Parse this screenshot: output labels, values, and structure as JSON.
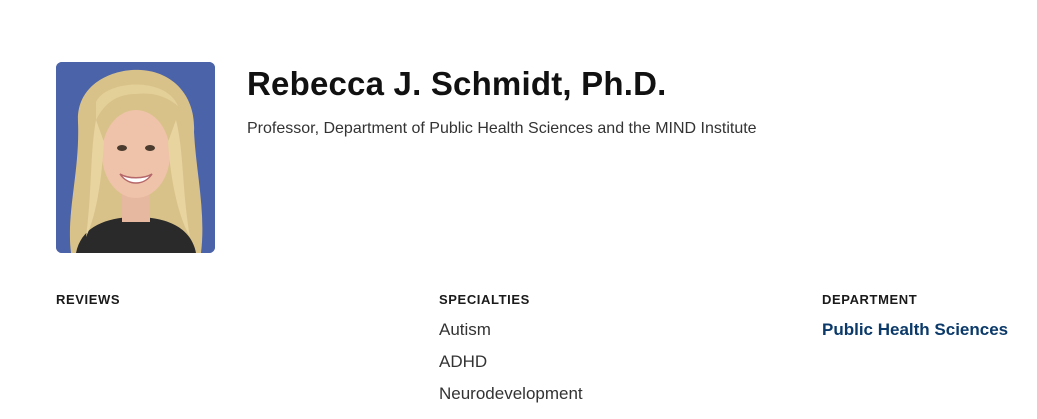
{
  "profile": {
    "name": "Rebecca J. Schmidt, Ph.D.",
    "title": "Professor, Department of Public Health Sciences and the MIND Institute"
  },
  "reviews": {
    "heading": "REVIEWS"
  },
  "specialties": {
    "heading": "SPECIALTIES",
    "items": [
      "Autism",
      "ADHD",
      "Neurodevelopment"
    ]
  },
  "department": {
    "heading": "DEPARTMENT",
    "link_label": "Public Health Sciences"
  },
  "colors": {
    "photo_background": "#4b63a8",
    "link": "#0b3a6a",
    "text": "#333333"
  }
}
